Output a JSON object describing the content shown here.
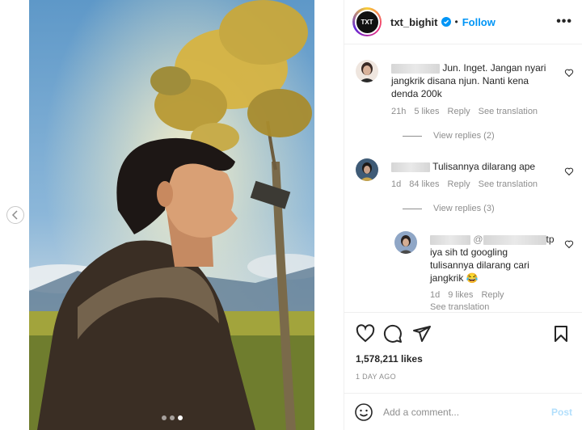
{
  "post": {
    "username": "txt_bighit",
    "follow_label": "Follow",
    "separator": "•",
    "more_label": "•••",
    "avatar_text": "TXT",
    "likes": "1,578,211 likes",
    "date": "1 DAY AGO",
    "image_dots": 3,
    "active_dot": 3
  },
  "comments": [
    {
      "text_line1": "Jun. Inget. Jangan nyari",
      "text_line2": "jangkrik disana njun. Nanti kena",
      "text_line3": "denda 200k",
      "time": "21h",
      "likes": "5 likes",
      "reply": "Reply",
      "translate": "See translation",
      "view_replies": "View replies (2)"
    },
    {
      "text_line1": "Tulisannya dilarang ape",
      "time": "1d",
      "likes": "84 likes",
      "reply": "Reply",
      "translate": "See translation",
      "view_replies": "View replies (3)"
    },
    {
      "handle_suffix": "tp",
      "text_line1": "iya sih td googling",
      "text_line2": "tulisannya dilarang cari",
      "text_line3": "jangkrik 😂",
      "time": "1d",
      "likes": "9 likes",
      "reply": "Reply",
      "translate": "See translation"
    }
  ],
  "composer": {
    "placeholder": "Add a comment...",
    "post_label": "Post"
  },
  "colors": {
    "accent": "#0095f6",
    "post_disabled": "#b2dffc",
    "muted": "#8e8e8e"
  },
  "icons": [
    "heart-icon",
    "comment-icon",
    "share-icon",
    "bookmark-icon",
    "emoji-icon",
    "verified-icon",
    "chevron-left-icon",
    "more-icon"
  ]
}
